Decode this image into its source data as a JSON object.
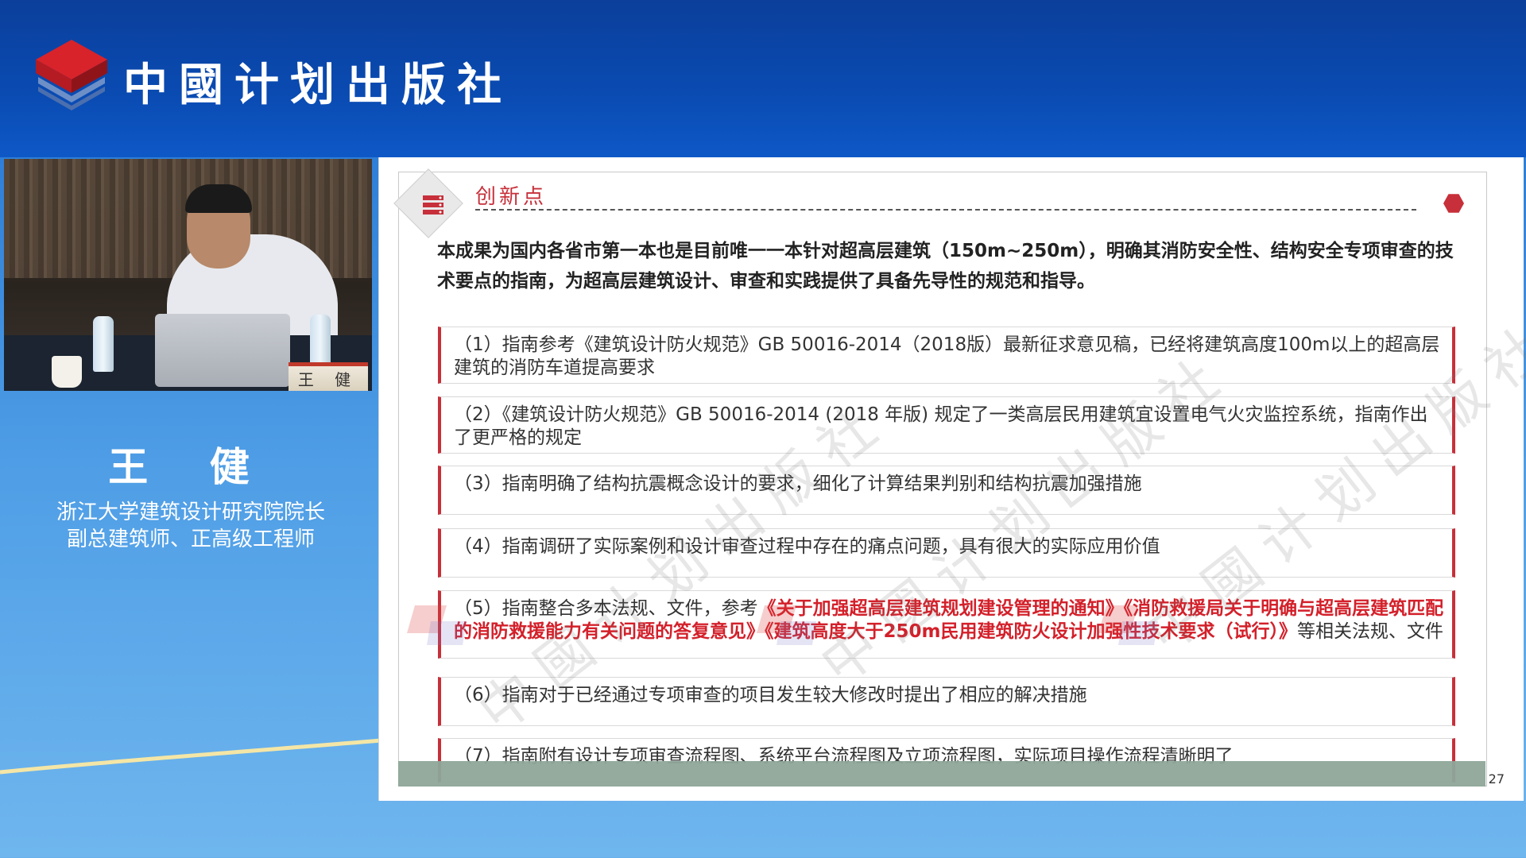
{
  "header": {
    "brand": "中國计划出版社"
  },
  "speaker": {
    "name": "王  健",
    "nameplate": "王 健",
    "title_line1": "浙江大学建筑设计研究院院长",
    "title_line2": "副总建筑师、正高级工程师"
  },
  "slide": {
    "section_title": "创新点",
    "intro": "本成果为国内各省市第一本也是目前唯一一本针对超高层建筑（150m~250m），明确其消防安全性、结构安全专项审查的技术要点的指南，为超高层建筑设计、审查和实践提供了具备先导性的规范和指导。",
    "items": [
      "（1）指南参考《建筑设计防火规范》GB 50016-2014（2018版）最新征求意见稿，已经将建筑高度100m以上的超高层建筑的消防车道提高要求",
      "（2）《建筑设计防火规范》GB 50016-2014 (2018 年版) 规定了一类高层民用建筑宜设置电气火灾监控系统，指南作出了更严格的规定",
      "（3）指南明确了结构抗震概念设计的要求，细化了计算结果判别和结构抗震加强措施",
      "（4）指南调研了实际案例和设计审查过程中存在的痛点问题，具有很大的实际应用价值",
      "",
      "（6）指南对于已经通过专项审查的项目发生较大修改时提出了相应的解决措施",
      "（7）指南附有设计专项审查流程图、系统平台流程图及立项流程图，实际项目操作流程清晰明了"
    ],
    "item5": {
      "prefix": "（5）指南整合多本法规、文件，参考",
      "highlight": "《关于加强超高层建筑规划建设管理的通知》《消防救援局关于明确与超高层建筑匹配的消防救援能力有关问题的答复意见》《建筑高度大于250m民用建筑防火设计加强性技术要求（试行）》",
      "suffix": "等相关法规、文件"
    },
    "page_number": "27",
    "watermark": "中國计划出版社"
  },
  "colors": {
    "accent_red": "#c7303a",
    "header_blue": "#0b3f9b"
  }
}
